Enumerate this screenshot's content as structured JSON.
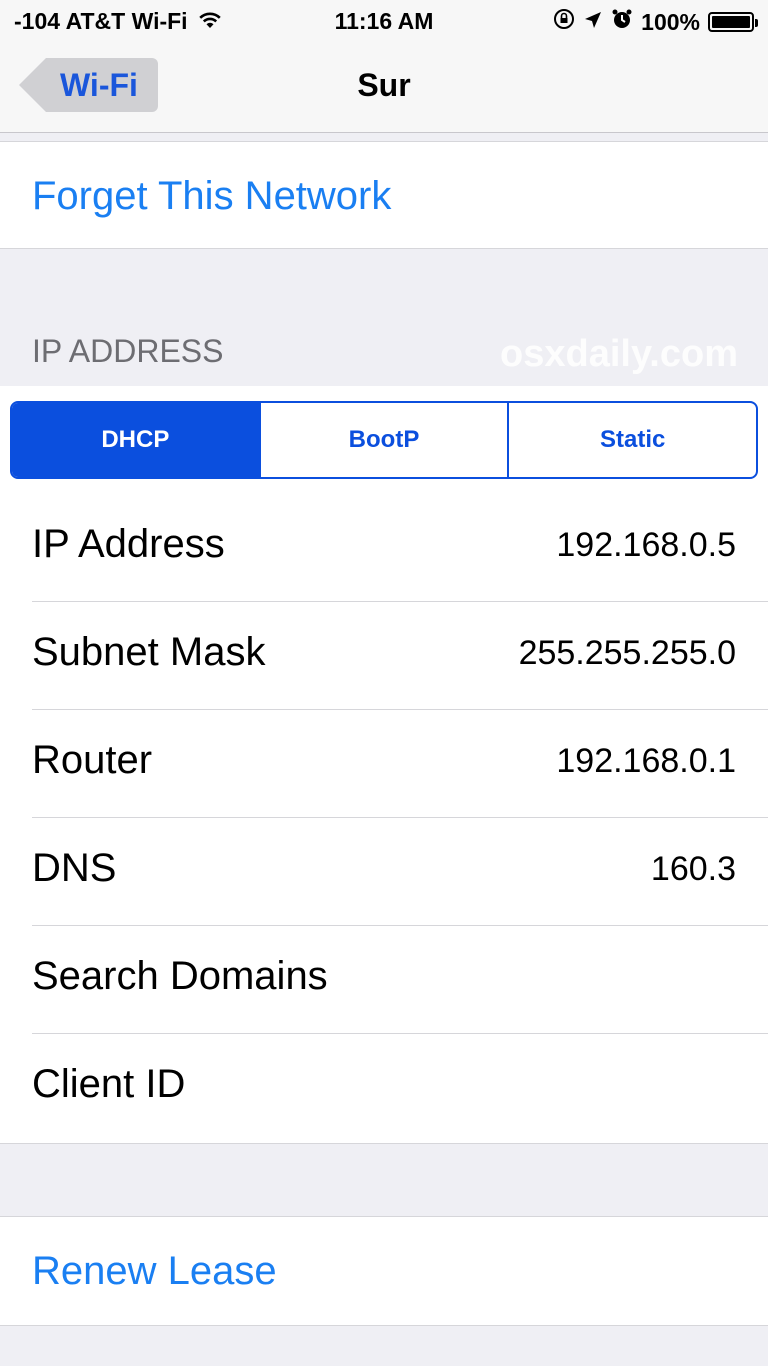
{
  "status_bar": {
    "carrier": "-104 AT&T Wi-Fi",
    "time": "11:16 AM",
    "battery": "100%",
    "icons": [
      "wifi-icon",
      "rotation-lock-icon",
      "location-icon",
      "alarm-icon",
      "battery-icon"
    ]
  },
  "nav": {
    "back_label": "Wi-Fi",
    "title": "Sur"
  },
  "forget_network": "Forget This Network",
  "ip_section": {
    "header": "IP ADDRESS",
    "watermark": "osxdaily.com"
  },
  "segmented": {
    "options": [
      "DHCP",
      "BootP",
      "Static"
    ],
    "selected": "DHCP"
  },
  "rows": [
    {
      "label": "IP Address",
      "value": "192.168.0.5"
    },
    {
      "label": "Subnet Mask",
      "value": "255.255.255.0"
    },
    {
      "label": "Router",
      "value": "192.168.0.1"
    },
    {
      "label": "DNS",
      "value": "160.3"
    },
    {
      "label": "Search Domains",
      "value": ""
    },
    {
      "label": "Client ID",
      "value": ""
    }
  ],
  "renew_lease": "Renew Lease",
  "colors": {
    "accent": "#1a7ff2",
    "segment": "#0b4fde",
    "background": "#efeff4"
  }
}
